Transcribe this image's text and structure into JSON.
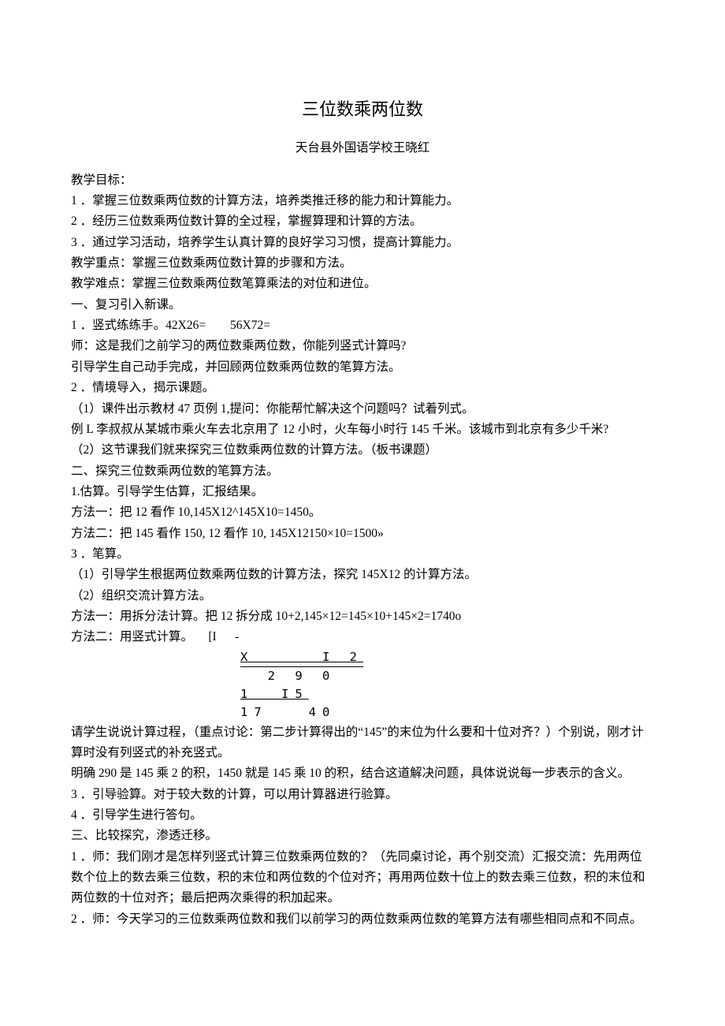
{
  "title": "三位数乘两位数",
  "author": "天台县外国语学校王晓红",
  "lines": {
    "l0": "教学目标：",
    "l1": "1 ．掌握三位数乘两位数的计算方法，培养类推迁移的能力和计算能力。",
    "l2": "2 ．经历三位数乘两位数计算的全过程，掌握算理和计算的方法。",
    "l3": "3 ．通过学习活动，培养学生认真计算的良好学习习惯，提高计算能力。",
    "l4": "教学重点：掌握三位数乘两位数计算的步骤和方法。",
    "l5": "教学难点：掌握三位数乘两位数笔算乘法的对位和进位。",
    "l6": "一、复习引入新课。",
    "l7": "1 ．竖式练练手。42X26=        56X72=",
    "l8": "师：这是我们之前学习的两位数乘两位数，你能列竖式计算吗?",
    "l9": "引导学生自己动手完成，并回顾两位数乘两位数的笔算方法。",
    "l10": "2 ．情境导入，揭示课题。",
    "l11": "（1）课件出示教材 47 页例 1,提问：你能帮忙解决这个问题吗？试着列式。",
    "l12": "例 L 李叔叔从某城市乘火车去北京用了 12 小时，火车每小时行 145 千米。该城市到北京有多少千米?",
    "l13": "（2）这节课我们就来探究三位数乘两位数的计算方法。（板书课题）",
    "l14": "二、探究三位数乘两位数的笔算方法。",
    "l15": "1.估算。引导学生估算，汇报结果。",
    "l16": "方法一：把 12 看作 10,145X12^145X10=1450。",
    "l17": "方法二：把 145 看作 150, 12 看作 10, 145X12150×10=1500»",
    "l18": "3 ．笔算。",
    "l19": "（1）引导学生根据两位数乘两位数的计算方法，探究 145X12 的计算方法。",
    "l20": "（2）组织交流计算方法。",
    "l21": "方法一：用拆分法计算。把 12 拆分成 10+2,145×12=145×10+145×2=1740o",
    "l22": "方法二：用竖式计算。     [I      -",
    "l23": "请学生说说计算过程，（重点讨论：第二步计算得出的“145”的末位为什么要和十位对齐？）个别说，刚才计算时没有列竖式的补充竖式。",
    "l24": "明确 290 是 145 乘 2 的积，1450 就是 145 乘 10 的积，结合这道解决问题，具体说说每一步表示的含义。",
    "l25": "3 ．引导验算。对于较大数的计算，可以用计算器进行验算。",
    "l26": "4 ．引导学生进行答句。",
    "l27": "三、比较探究，渗透迁移。",
    "l28": "1 ．师：我们刚才是怎样列竖式计算三位数乘两位数的？（先同桌讨论，再个别交流）汇报交流：先用两位数个位上的数去乘三位数，积的末位和两位数的个位对齐；再用两位数十位上的数去乘三位数，积的末位和两位数的十位对齐；最后把两次乘得的积加起来。",
    "l29": "2 ．师：今天学习的三位数乘两位数和我们以前学习的两位数乘两位数的笔算方法有哪些相同点和不同点。"
  },
  "calc": {
    "r1": "X     I 2",
    "r2": "  2 9 0",
    "r3": "1  I5",
    "r4": "17   40"
  }
}
